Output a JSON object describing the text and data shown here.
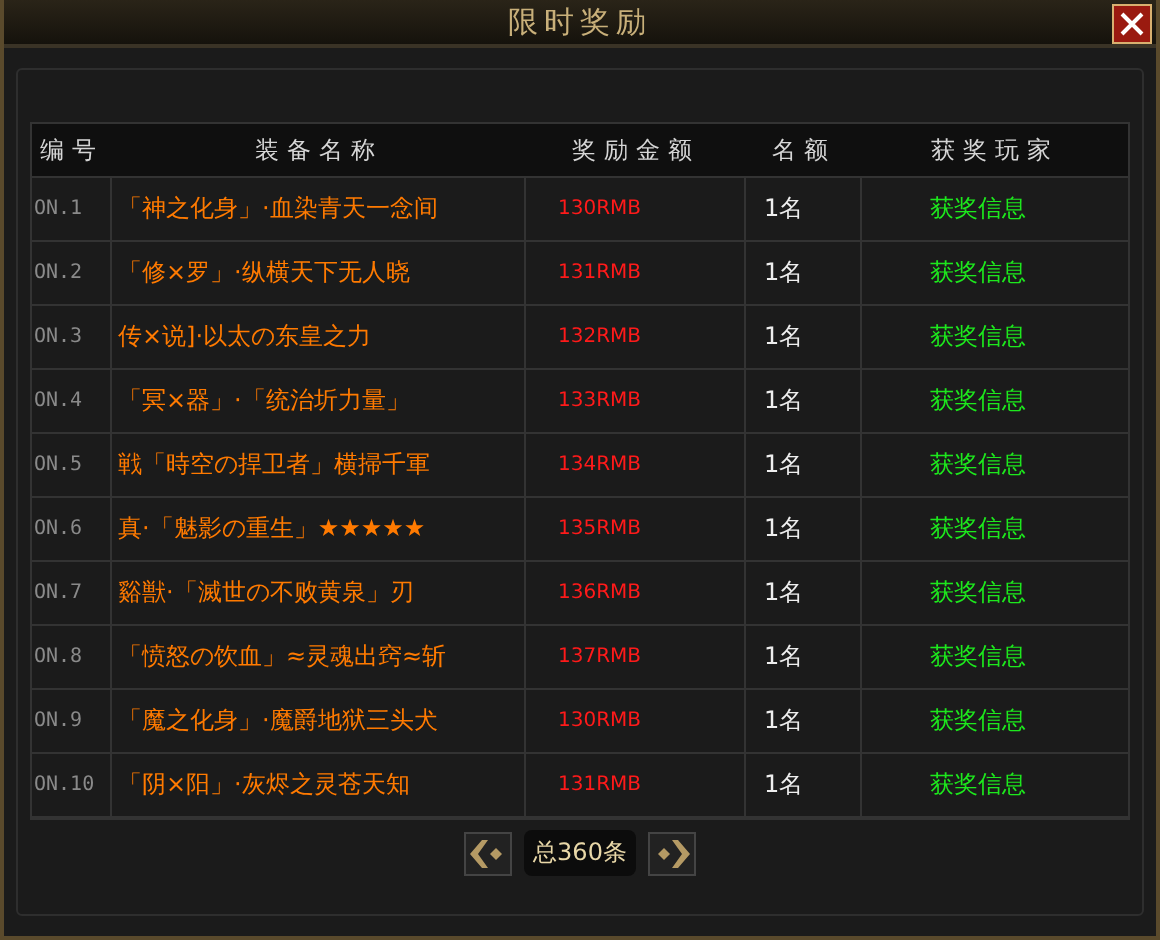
{
  "window": {
    "title": "限时奖励"
  },
  "table": {
    "columns": [
      "编号",
      "装备名称",
      "奖励金额",
      "名额",
      "获奖玩家"
    ],
    "rows": [
      {
        "number": "ON.1",
        "item": "「神之化身」·血染青天一念间",
        "reward": "130RMB",
        "quota": "1名",
        "winner": "获奖信息"
      },
      {
        "number": "ON.2",
        "item": "「修×罗」·纵横天下无人晓",
        "reward": "131RMB",
        "quota": "1名",
        "winner": "获奖信息"
      },
      {
        "number": "ON.3",
        "item": "传×说]·以太の东皇之力",
        "reward": "132RMB",
        "quota": "1名",
        "winner": "获奖信息"
      },
      {
        "number": "ON.4",
        "item": "「冥×器」·「统治圻力量」",
        "reward": "133RMB",
        "quota": "1名",
        "winner": "获奖信息"
      },
      {
        "number": "ON.5",
        "item": "戦「時空の捍卫者」横掃千軍",
        "reward": "134RMB",
        "quota": "1名",
        "winner": "获奖信息"
      },
      {
        "number": "ON.6",
        "item": "真·「魅影の重生」★★★★★",
        "reward": "135RMB",
        "quota": "1名",
        "winner": "获奖信息"
      },
      {
        "number": "ON.7",
        "item": "谿獣·「滅世の不败黄泉」刃",
        "reward": "136RMB",
        "quota": "1名",
        "winner": "获奖信息"
      },
      {
        "number": "ON.8",
        "item": "「愤怒の饮血」≈灵魂出窍≈斩",
        "reward": "137RMB",
        "quota": "1名",
        "winner": "获奖信息"
      },
      {
        "number": "ON.9",
        "item": "「魔之化身」·魔爵地狱三头犬",
        "reward": "130RMB",
        "quota": "1名",
        "winner": "获奖信息"
      },
      {
        "number": "ON.10",
        "item": "「阴×阳」·灰烬之灵苍天知",
        "reward": "131RMB",
        "quota": "1名",
        "winner": "获奖信息"
      }
    ]
  },
  "pagination": {
    "total": "总360条"
  }
}
